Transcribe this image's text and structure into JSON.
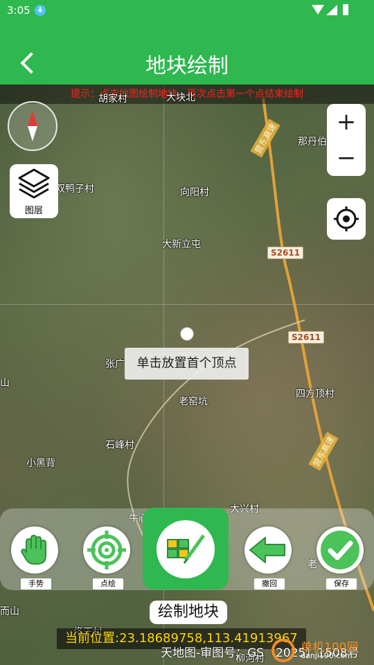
{
  "status_bar": {
    "time": "3:05"
  },
  "header": {
    "title": "地块绘制"
  },
  "map": {
    "hint": "提示：点击地图绘制地块，再次点击第一个点结束绘制",
    "places": [
      "胡家村",
      "大块北",
      "那丹伯",
      "双鸭子村",
      "向阳村",
      "大新立屯",
      "张广",
      "老窑坑",
      "四方顶村",
      "石峰村",
      "小黑背",
      "牛心",
      "大兴村",
      "老",
      "佟王村",
      "柳河村",
      "而山",
      "山"
    ],
    "road_tags": [
      "S2611",
      "S2611"
    ],
    "highway_labels": [
      "营东高速",
      "营东高速"
    ],
    "placement_tip": "单击放置首个顶点",
    "layer_label": "图层",
    "zoom_in": "+",
    "zoom_out": "−"
  },
  "toolbar": {
    "gesture_label": "手势",
    "point_label": "点绘",
    "main_label": "绘制地块",
    "undo_label": "撤回",
    "save_label": "保存"
  },
  "footer": {
    "coordinates": "当前位置:23.18689758,113.41913967",
    "copyright": "天地图-审图号：GS（2025）1508号",
    "watermark_main": "单机100网",
    "watermark_sub": "danji100.com"
  },
  "colors": {
    "brand_green": "#2eb84f",
    "hint_red": "#ff2020",
    "coord_yellow": "#ffd600"
  }
}
